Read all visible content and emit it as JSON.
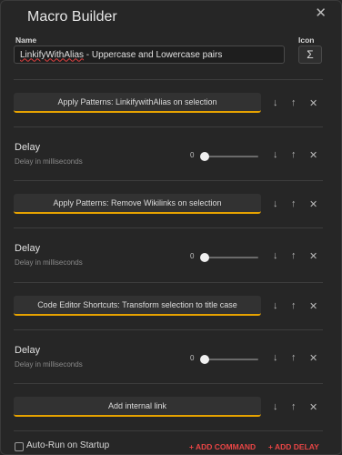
{
  "modal": {
    "title": "Macro Builder",
    "close": "✕"
  },
  "name_field": {
    "label": "Name",
    "value_underlined": "LinkifyWithAlias",
    "value_rest": " - Uppercase and Lowercase pairs"
  },
  "icon_field": {
    "label": "Icon",
    "value": "Σ"
  },
  "controls": {
    "down": "↓",
    "up": "↑",
    "remove": "✕"
  },
  "commands": [
    {
      "label": "Apply Patterns: LinkifywithAlias on selection"
    },
    {
      "label": "Apply Patterns: Remove Wikilinks on selection"
    },
    {
      "label": "Code Editor Shortcuts: Transform selection to title case"
    },
    {
      "label": "Add internal link"
    }
  ],
  "delays": [
    {
      "title": "Delay",
      "description": "Delay in milliseconds",
      "value": "0"
    },
    {
      "title": "Delay",
      "description": "Delay in milliseconds",
      "value": "0"
    },
    {
      "title": "Delay",
      "description": "Delay in milliseconds",
      "value": "0"
    }
  ],
  "footer": {
    "auto_run_label": "Auto-Run on Startup",
    "add_command": "+ ADD COMMAND",
    "add_delay": "+ ADD DELAY"
  },
  "colors": {
    "accent": "#e6a200",
    "link": "#e84545",
    "background": "#262626"
  }
}
